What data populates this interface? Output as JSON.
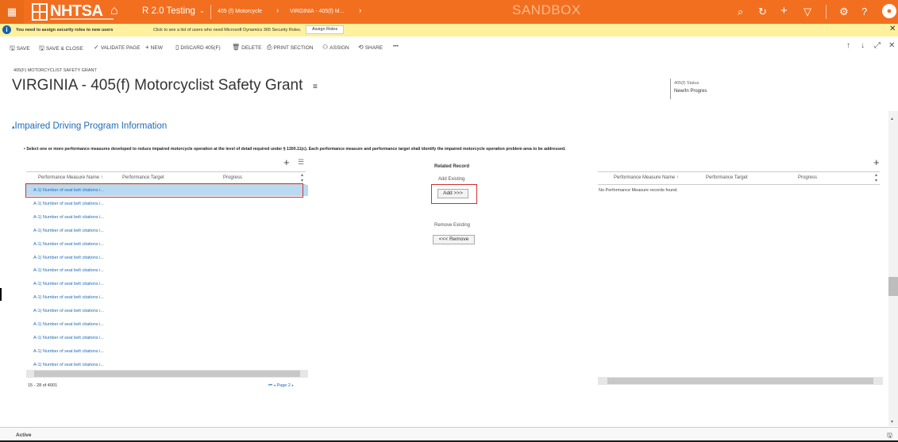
{
  "topbar": {
    "logo_text": "NHTSA",
    "crumbs": [
      "R 2.0 Testing",
      "405 (f) Motorcycle",
      "VIRGINIA - 405(f) M..."
    ],
    "sandbox": "SANDBOX",
    "accent": "#f26f1f"
  },
  "notice": {
    "bold_text": "You need to assign security roles to new users",
    "rest_text": "Click to see a list of users who need Microsoft Dynamics 365 Security Roles.",
    "button": "Assign Roles"
  },
  "commands": {
    "save": "SAVE",
    "save_close": "SAVE & CLOSE",
    "validate": "VALIDATE PAGE",
    "new": "NEW",
    "discard": "DISCARD 405(F)",
    "delete": "DELETE",
    "print": "PRINT SECTION",
    "assign": "ASSIGN",
    "share": "SHARE",
    "more": "•••"
  },
  "record": {
    "entity_type": "405(F) MOTORCYCLIST SAFETY GRANT",
    "title": "VIRGINIA - 405(f) Motorcyclist Safety Grant",
    "status_label": "405(f) Status",
    "status_value": "New/In Progres"
  },
  "section": {
    "title": "Impaired Driving Program Information",
    "instructions": "• Select one or more performance measures developed to reduce impaired motorcycle operation at the level of detail required under § 1300.11(c). Each performance measure and performance target shall identify the impaired motorcycle operation problem area to be addressed."
  },
  "left_grid": {
    "columns": [
      "Performance Measure Name ↑",
      "Performance Target",
      "Progress"
    ],
    "rows": [
      "A-1) Number of seat belt citations i...",
      "A-1) Number of seat belt citations i...",
      "A-1) Number of seat belt citations i...",
      "A-1) Number of seat belt citations i...",
      "A-1) Number of seat belt citations i...",
      "A-1) Number of seat belt citations i...",
      "A-1) Number of seat belt citations i...",
      "A-1) Number of seat belt citations i...",
      "A-1) Number of seat belt citations i...",
      "A-1) Number of seat belt citations i...",
      "A-1) Number of seat belt citations i...",
      "A-1) Number of seat belt citations i...",
      "A-1) Number of seat belt citations i...",
      "A-1) Number of seat belt citations i..."
    ],
    "range": "15 - 28 of 4001",
    "page": "Page 2"
  },
  "related": {
    "title": "Related Record",
    "add_existing": "Add Existing",
    "add_button": "Add >>>",
    "remove_existing": "Remove Existing",
    "remove_button": "<<< Remove"
  },
  "right_grid": {
    "columns": [
      "Performance Measure Name ↑",
      "Performance Target",
      "Progress"
    ],
    "empty": "No Performance Measure records found."
  },
  "footer": {
    "status": "Active"
  }
}
